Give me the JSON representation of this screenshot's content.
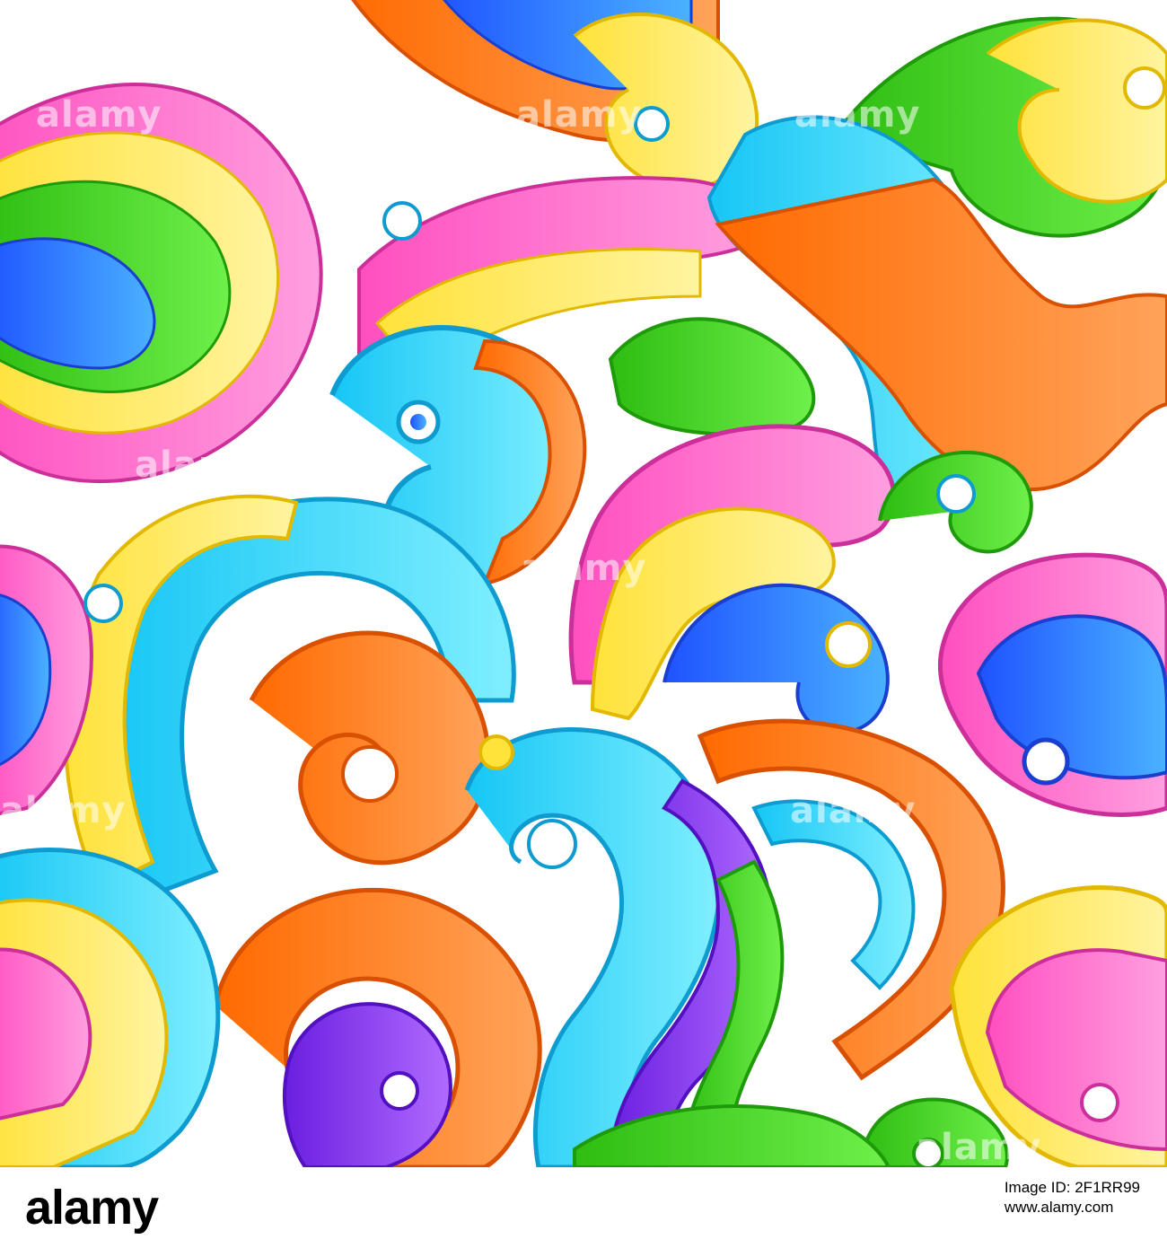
{
  "image": {
    "description_icon": "rainbow-swirl-pattern-icon",
    "palette": [
      "#ff66cc",
      "#ffe94a",
      "#ffb01f",
      "#ff7a1a",
      "#44d21e",
      "#2bd4ff",
      "#3aa8ff",
      "#2a5cff",
      "#8f3cff",
      "#ffffff"
    ]
  },
  "watermark": {
    "text": "alamy"
  },
  "footer": {
    "logo": "alamy",
    "line": "Image ID: 2F1RR99",
    "url": "www.alamy.com",
    "id": "2F1RR99"
  }
}
